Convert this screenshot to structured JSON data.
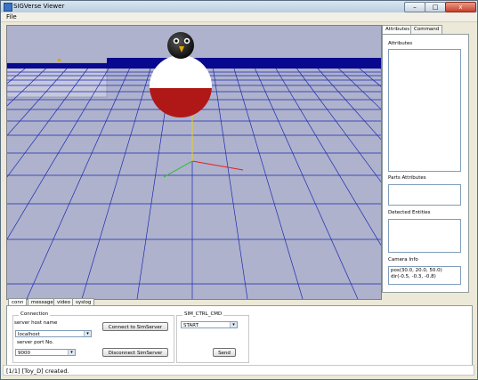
{
  "window": {
    "title": "SIGVerse Viewer",
    "buttons": {
      "minimize": "–",
      "maximize": "□",
      "close": "x"
    }
  },
  "menu": {
    "file": "File"
  },
  "right_tabs": [
    "Attributes",
    "Command"
  ],
  "right_panel": {
    "attributes_label": "Attributes",
    "parts_label": "Parts Attributes",
    "entities_label": "Detected Entities",
    "camera_label": "Camera Info",
    "camera_pos": "pos(30.0, 20.0, 50.0)",
    "camera_dir": "dir(-0.5, -0.3, -0.8)"
  },
  "bottom_tabs": [
    "conn",
    "messages",
    "video",
    "syslog"
  ],
  "connection": {
    "group_title": "Connection",
    "host_label": "server host name",
    "host_value": "localhost",
    "port_label": "server port No.",
    "port_value": "9000",
    "connect_button": "Connect to SimServer",
    "disconnect_button": "Disconnect SimServer"
  },
  "sim_ctrl": {
    "group_title": "SIM_CTRL_CMD",
    "command_value": "START",
    "send_button": "Send"
  },
  "status": {
    "message": "[1/1] [Toy_D] created."
  },
  "colors": {
    "sky": "#aeb2cc",
    "grid": "#1c2ab0",
    "horizon": "#00008b",
    "ball_top": "#ffffff",
    "ball_bottom": "#b01818"
  },
  "icons": {
    "app": "app-icon",
    "dropdown": "chevron-down-icon"
  }
}
